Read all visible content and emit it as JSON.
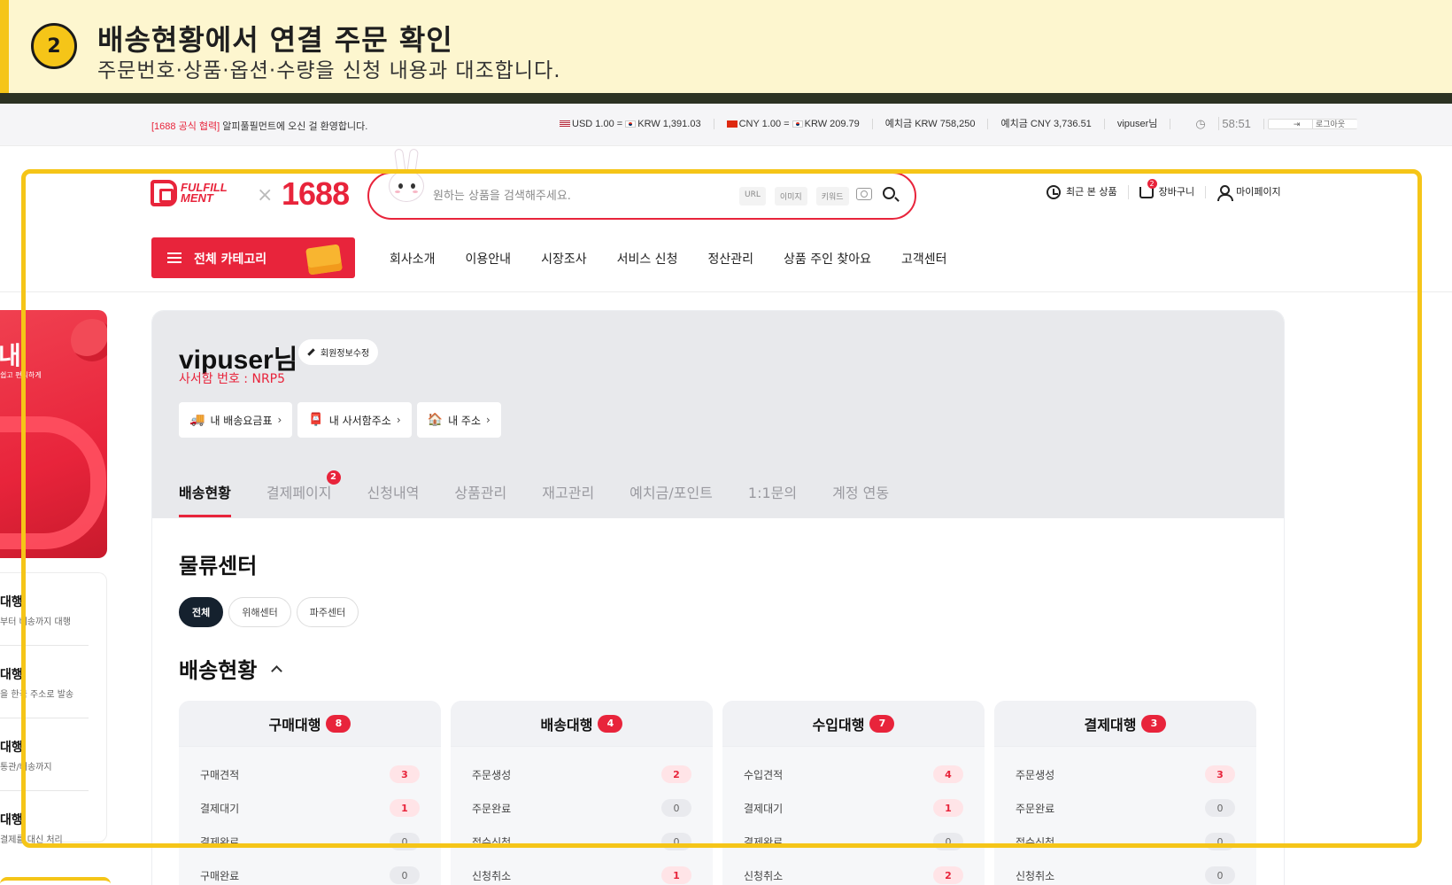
{
  "instruction": {
    "step": "2",
    "title": "배송현황에서 연결 주문 확인",
    "subtitle": "주문번호·상품·옵션·수량을 신청 내용과 대조합니다."
  },
  "topbar": {
    "welcome_tag": "[1688 공식 협력]",
    "welcome_text": "알피풀필먼트에 오신 걸 환영합니다.",
    "usd_rate": "USD 1.00 = ",
    "usd_krw": "KRW 1,391.03",
    "cny_rate": "CNY 1.00 = ",
    "cny_krw": "KRW 209.79",
    "deposit_krw": "예치금 KRW 758,250",
    "deposit_cny": "예치금 CNY 3,736.51",
    "user": "vipuser님",
    "timer": "58:51",
    "logout": "로그아웃"
  },
  "header": {
    "logo_line1": "FULFILL",
    "logo_line2": "MENT",
    "logo_x": "×",
    "logo_1688": "1688",
    "search_placeholder": "원하는 상품을 검색해주세요.",
    "search_chips": [
      "URL",
      "이미지",
      "키워드"
    ],
    "recent": "최근 본 상품",
    "cart": "장바구니",
    "cart_badge": "2",
    "mypage": "마이페이지"
  },
  "nav": {
    "category": "전체 카테고리",
    "items": [
      "회사소개",
      "이용안내",
      "시장조사",
      "서비스 신청",
      "정산관리",
      "상품 주인 찾아요",
      "고객센터"
    ]
  },
  "sidebar": {
    "banner_big": "내",
    "banner_small": "쉽고 편리하게",
    "items": [
      {
        "title": "대행",
        "desc": "부터 배송까지 대행"
      },
      {
        "title": "대행",
        "desc": "을 한국 주소로 발송"
      },
      {
        "title": "대행",
        "desc": "통관/배송까지"
      },
      {
        "title": "대행",
        "desc": "결제를 대신 처리"
      }
    ]
  },
  "profile": {
    "username": "vipuser님",
    "edit": "회원정보수정",
    "pobox": "사서함 번호 : NRP5",
    "quick": [
      {
        "icon": "🚚",
        "label": "내 배송요금표"
      },
      {
        "icon": "📮",
        "label": "내 사서함주소"
      },
      {
        "icon": "🏠",
        "label": "내 주소"
      }
    ]
  },
  "tabs": [
    {
      "label": "배송현황",
      "active": true,
      "badge": ""
    },
    {
      "label": "결제페이지",
      "active": false,
      "badge": "2"
    },
    {
      "label": "신청내역",
      "active": false,
      "badge": ""
    },
    {
      "label": "상품관리",
      "active": false,
      "badge": ""
    },
    {
      "label": "재고관리",
      "active": false,
      "badge": ""
    },
    {
      "label": "예치금/포인트",
      "active": false,
      "badge": ""
    },
    {
      "label": "1:1문의",
      "active": false,
      "badge": ""
    },
    {
      "label": "계정 연동",
      "active": false,
      "badge": ""
    }
  ],
  "logistics": {
    "title": "물류센터",
    "filters": [
      "전체",
      "위해센터",
      "파주센터"
    ]
  },
  "delivery": {
    "title": "배송현황",
    "cards": [
      {
        "title": "구매대행",
        "count": "8",
        "rows": [
          {
            "label": "구매견적",
            "value": "3"
          },
          {
            "label": "결제대기",
            "value": "1"
          },
          {
            "label": "결제완료",
            "value": "0"
          },
          {
            "label": "구매완료",
            "value": "0"
          }
        ]
      },
      {
        "title": "배송대행",
        "count": "4",
        "rows": [
          {
            "label": "주문생성",
            "value": "2"
          },
          {
            "label": "주문완료",
            "value": "0"
          },
          {
            "label": "접수신청",
            "value": "0"
          },
          {
            "label": "신청취소",
            "value": "1"
          }
        ]
      },
      {
        "title": "수입대행",
        "count": "7",
        "rows": [
          {
            "label": "수입견적",
            "value": "4"
          },
          {
            "label": "결제대기",
            "value": "1"
          },
          {
            "label": "결제완료",
            "value": "0"
          },
          {
            "label": "신청취소",
            "value": "2"
          }
        ]
      },
      {
        "title": "결제대행",
        "count": "3",
        "rows": [
          {
            "label": "주문생성",
            "value": "3"
          },
          {
            "label": "주문완료",
            "value": "0"
          },
          {
            "label": "접수신청",
            "value": "0"
          },
          {
            "label": "신청취소",
            "value": "0"
          }
        ]
      }
    ]
  },
  "colors": {
    "brand_red": "#e8243b",
    "highlight_yellow": "#f5c518",
    "banner_bg": "#fdf6cf"
  }
}
